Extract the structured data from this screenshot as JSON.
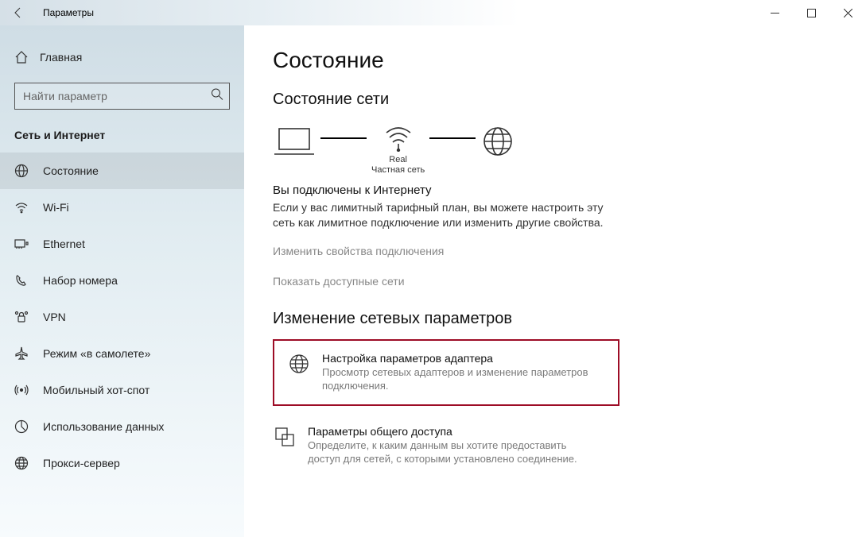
{
  "window": {
    "title": "Параметры"
  },
  "sidebar": {
    "home": "Главная",
    "search_placeholder": "Найти параметр",
    "category": "Сеть и Интернет",
    "items": [
      {
        "label": "Состояние"
      },
      {
        "label": "Wi-Fi"
      },
      {
        "label": "Ethernet"
      },
      {
        "label": "Набор номера"
      },
      {
        "label": "VPN"
      },
      {
        "label": "Режим «в самолете»"
      },
      {
        "label": "Мобильный хот-спот"
      },
      {
        "label": "Использование данных"
      },
      {
        "label": "Прокси-сервер"
      }
    ]
  },
  "main": {
    "title": "Состояние",
    "status_heading": "Состояние сети",
    "diagram": {
      "name": "Real",
      "type": "Частная сеть"
    },
    "connected_title": "Вы подключены к Интернету",
    "connected_body": "Если у вас лимитный тарифный план, вы можете настроить эту сеть как лимитное подключение или изменить другие свойства.",
    "link_change_props": "Изменить свойства подключения",
    "link_show_networks": "Показать доступные сети",
    "change_heading": "Изменение сетевых параметров",
    "tiles": [
      {
        "title": "Настройка параметров адаптера",
        "desc": "Просмотр сетевых адаптеров и изменение параметров подключения."
      },
      {
        "title": "Параметры общего доступа",
        "desc": "Определите, к каким данным вы хотите предоставить доступ для сетей, с которыми установлено соединение."
      }
    ]
  }
}
